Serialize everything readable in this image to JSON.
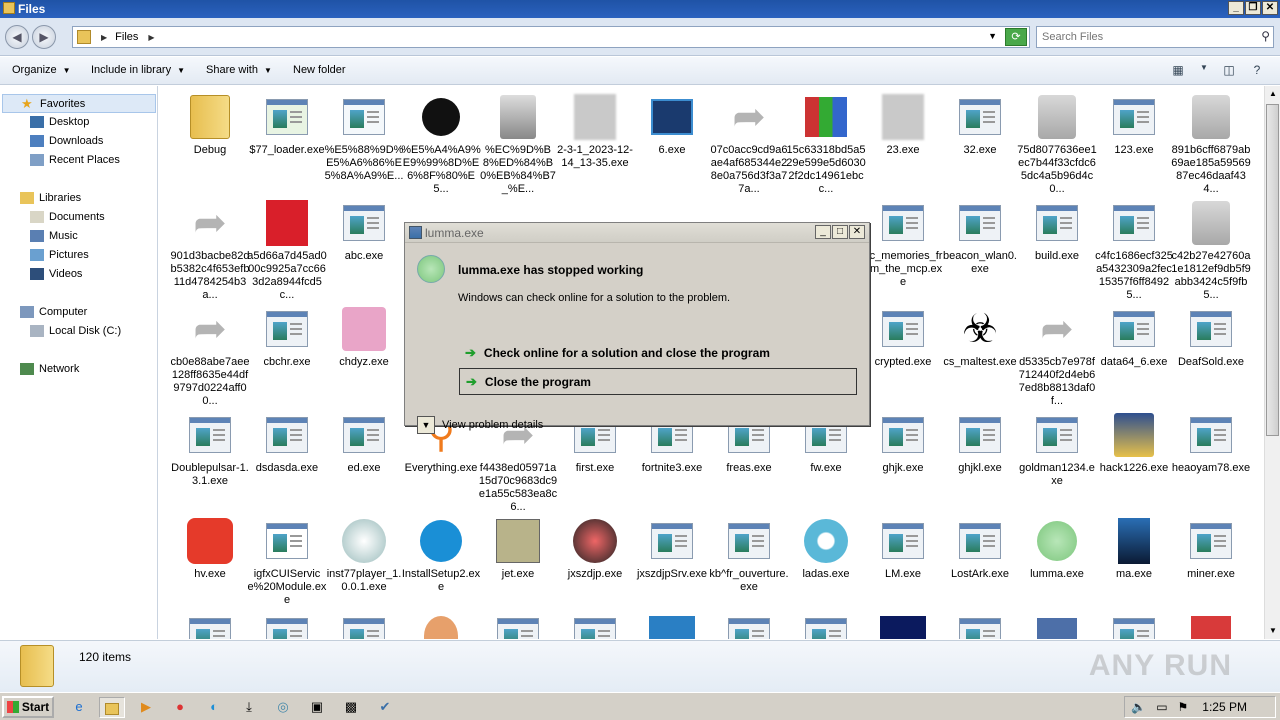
{
  "window": {
    "title": "Files"
  },
  "address": {
    "crumb": "Files",
    "search_placeholder": "Search Files"
  },
  "toolbar": {
    "organize": "Organize",
    "include": "Include in library",
    "share": "Share with",
    "new_folder": "New folder"
  },
  "nav": {
    "favorites": "Favorites",
    "desktop": "Desktop",
    "downloads": "Downloads",
    "recent": "Recent Places",
    "libraries": "Libraries",
    "documents": "Documents",
    "music": "Music",
    "pictures": "Pictures",
    "videos": "Videos",
    "computer": "Computer",
    "local_disk": "Local Disk (C:)",
    "network": "Network"
  },
  "files": {
    "r0": [
      "Debug",
      "$77_loader.exe",
      "%E5%88%9D%E5%A6%86%E5%8A%A9%E...",
      "%E5%A4%A9%E9%99%8D%E6%8F%80%E5...",
      "%EC%9D%B8%ED%84%B0%EB%84%B7_%E...",
      "2-3-1_2023-12-14_13-35.exe",
      "6.exe",
      "07c0acc9cd9a6ae4af685344e28e0a756d3f3a77a...",
      "15c63318bd5a529e599e5d60302f2dc14961ebcc...",
      "23.exe",
      "32.exe",
      "75d8077636ee1ec7b44f33cfdc65dc4a5b96d4c0...",
      "123.exe",
      "891b6cff6879ab69ae185a5956987ec46daaf434..."
    ],
    "r1": [
      "901d3bacbe82db5382c4f653efb11d4784254b3a...",
      "a5d66a7d45ad000c9925a7cc663d2a8944fcd5c...",
      "abc.exe",
      "bc_memories_from_the_mcp.exe",
      "beacon_wlan0.exe",
      "build.exe",
      "c4fc1686ecf325a5432309a2fec15357f6ff84925...",
      "c42b27e42760a1e1812ef9db5f9abb3424c5f9fb5..."
    ],
    "r2": [
      "cb0e88abe7aee128ff8635e44df9797d0224aff00...",
      "cbchr.exe",
      "chdyz.exe",
      "crypted.exe",
      "cs_maltest.exe",
      "d5335cb7e978f712440f2d4eb67ed8b8813daf0f...",
      "data64_6.exe",
      "DeafSold.exe"
    ],
    "r3": [
      "Doublepulsar-1.3.1.exe",
      "dsdasda.exe",
      "ed.exe",
      "Everything.exe",
      "f4438ed05971a15d70c9683dc9e1a55c583ea8c6...",
      "first.exe",
      "fortnite3.exe",
      "freas.exe",
      "fw.exe",
      "ghjk.exe",
      "ghjkl.exe",
      "goldman1234.exe",
      "hack1226.exe",
      "heaoyam78.exe"
    ],
    "r4": [
      "hv.exe",
      "igfxCUIService%20Module.exe",
      "inst77player_1.0.0.1.exe",
      "InstallSetup2.exe",
      "jet.exe",
      "jxszdjp.exe",
      "jxszdjpSrv.exe",
      "kb^fr_ouverture.exe",
      "ladas.exe",
      "LM.exe",
      "LostArk.exe",
      "lumma.exe",
      "ma.exe",
      "miner.exe"
    ]
  },
  "details": {
    "count": "120 items",
    "watermark": "ANY RUN"
  },
  "taskbar": {
    "start": "Start",
    "time": "1:25 PM"
  },
  "dialog": {
    "title": "lumma.exe",
    "heading": "lumma.exe has stopped working",
    "sub": "Windows can check online for a solution to the problem.",
    "opt1": "Check online for a solution and close the program",
    "opt2": "Close the program",
    "details": "View problem details"
  },
  "colors": {
    "titlebar": "#1f53a6",
    "accent_green": "#1f9e2c",
    "dialog_bg": "#d4d0c8"
  }
}
